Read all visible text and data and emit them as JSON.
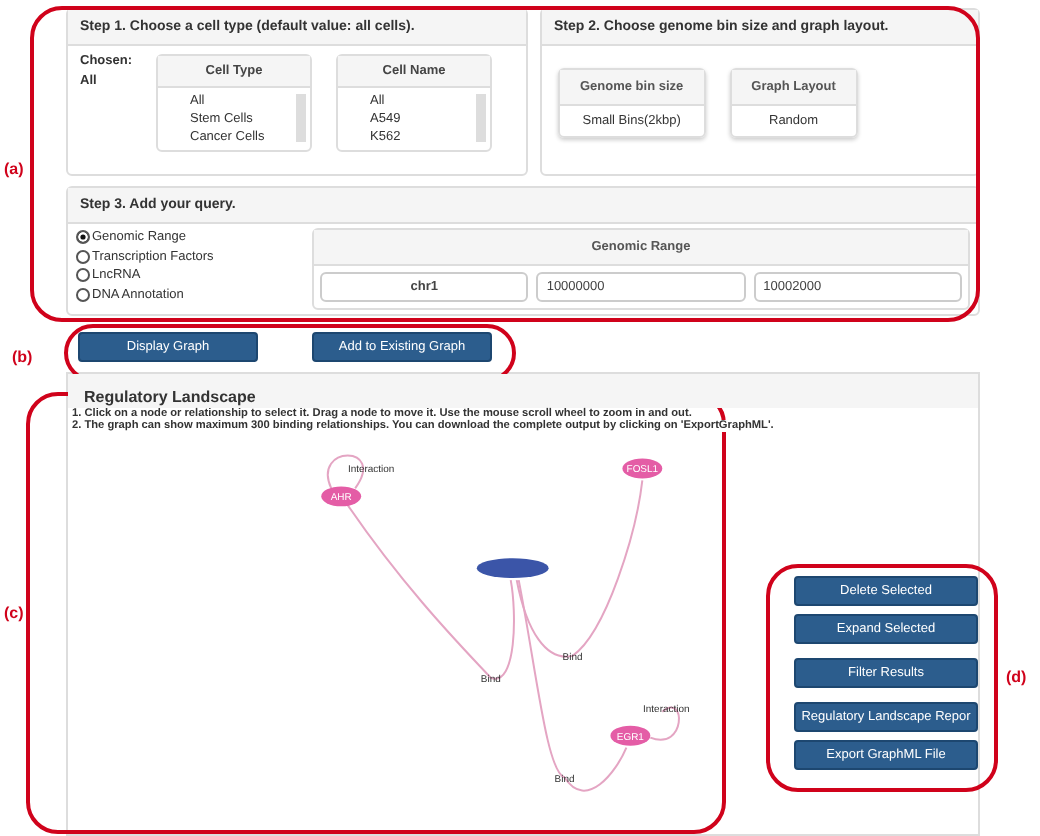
{
  "step1": {
    "title": "Step 1. Choose a cell type (default value: all cells).",
    "chosen_label": "Chosen:",
    "chosen_value": "All",
    "lists": [
      {
        "heading": "Cell Type",
        "items": [
          "All",
          "Stem Cells",
          "Cancer Cells"
        ]
      },
      {
        "heading": "Cell Name",
        "items": [
          "All",
          "A549",
          "K562"
        ]
      }
    ]
  },
  "step2": {
    "title": "Step 2. Choose genome bin size and graph layout.",
    "selects": [
      {
        "heading": "Genome bin size",
        "value": "Small Bins(2kbp)"
      },
      {
        "heading": "Graph Layout",
        "value": "Random"
      }
    ]
  },
  "step3": {
    "title": "Step 3. Add your query.",
    "options": [
      {
        "label": "Genomic Range",
        "selected": true
      },
      {
        "label": "Transcription Factors",
        "selected": false
      },
      {
        "label": "LncRNA",
        "selected": false
      },
      {
        "label": "DNA Annotation",
        "selected": false
      }
    ],
    "range_heading": "Genomic Range",
    "fields": [
      {
        "kind": "select",
        "value": "chr1"
      },
      {
        "kind": "input",
        "value": "10000000"
      },
      {
        "kind": "input",
        "value": "10002000"
      }
    ]
  },
  "actions": [
    "Display Graph",
    "Add to Existing Graph"
  ],
  "landscape": {
    "title": "Regulatory Landscape",
    "instructions": [
      "1. Click on a node or relationship to select it. Drag a node to move it. Use the mouse scroll wheel to zoom in and out.",
      "2. The graph can show maximum 300 binding relationships. You can download the complete output by clicking on 'ExportGraphML'."
    ],
    "nodes": [
      {
        "kind": "factor",
        "label": "AHR"
      },
      {
        "kind": "factor",
        "label": "FOSL1"
      },
      {
        "kind": "region"
      },
      {
        "kind": "factor",
        "label": "EGR1"
      }
    ],
    "edge_labels": [
      "Interaction",
      "Bind",
      "Bind",
      "Bind",
      "Interaction"
    ],
    "buttons": [
      "Delete Selected",
      "Expand Selected",
      "Filter Results",
      "Regulatory Landscape Repor",
      "Export GraphML File"
    ]
  },
  "annotations": [
    "(a)",
    "(b)",
    "(c)",
    "(d)"
  ]
}
